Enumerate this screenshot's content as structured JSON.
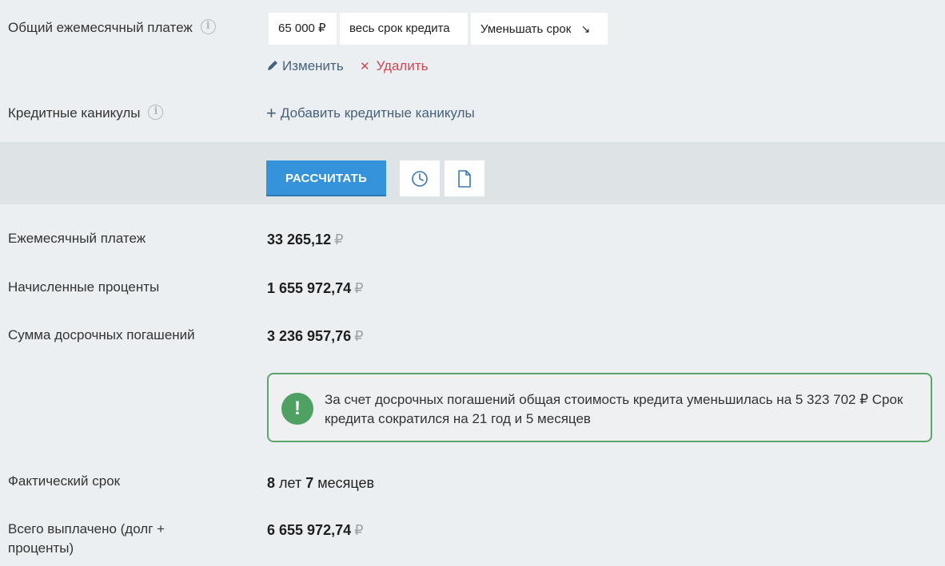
{
  "payment_section": {
    "label": "Общий ежемесячный платеж",
    "chips": {
      "amount": "65 000 ₽",
      "period": "весь срок кредита",
      "mode": "Уменьшать срок",
      "mode_arrow": "↘"
    },
    "edit_label": "Изменить",
    "delete_label": "Удалить"
  },
  "holidays_section": {
    "label": "Кредитные каникулы",
    "add_label": "Добавить кредитные каникулы"
  },
  "toolbar": {
    "calculate_label": "РАССЧИТАТЬ",
    "history_icon": "clock-icon",
    "document_icon": "document-icon"
  },
  "results": {
    "monthly_payment": {
      "label": "Ежемесячный платеж",
      "value": "33 265,12",
      "currency": "₽"
    },
    "interest": {
      "label": "Начисленные проценты",
      "value": "1 655 972,74",
      "currency": "₽"
    },
    "prepayments": {
      "label": "Сумма досрочных погашений",
      "value": "3 236 957,76",
      "currency": "₽"
    },
    "notice": {
      "icon": "!",
      "text": "За счет досрочных погашений общая стоимость кредита уменьшилась на 5 323 702 ₽ Срок кредита сократился на 21 год и 5 месяцев"
    },
    "actual_term": {
      "label": "Фактический срок",
      "years": "8",
      "years_word": "лет",
      "months": "7",
      "months_word": "месяцев"
    },
    "total_paid": {
      "label_line1": "Всего выплачено (долг +",
      "label_line2": "проценты)",
      "value": "6 655 972,74",
      "currency": "₽"
    }
  },
  "colors": {
    "background": "#eceff1",
    "toolbar": "#dee3e6",
    "primary_button": "#3593db",
    "link": "#46617c",
    "danger": "#d0454f",
    "success": "#4fa063"
  }
}
